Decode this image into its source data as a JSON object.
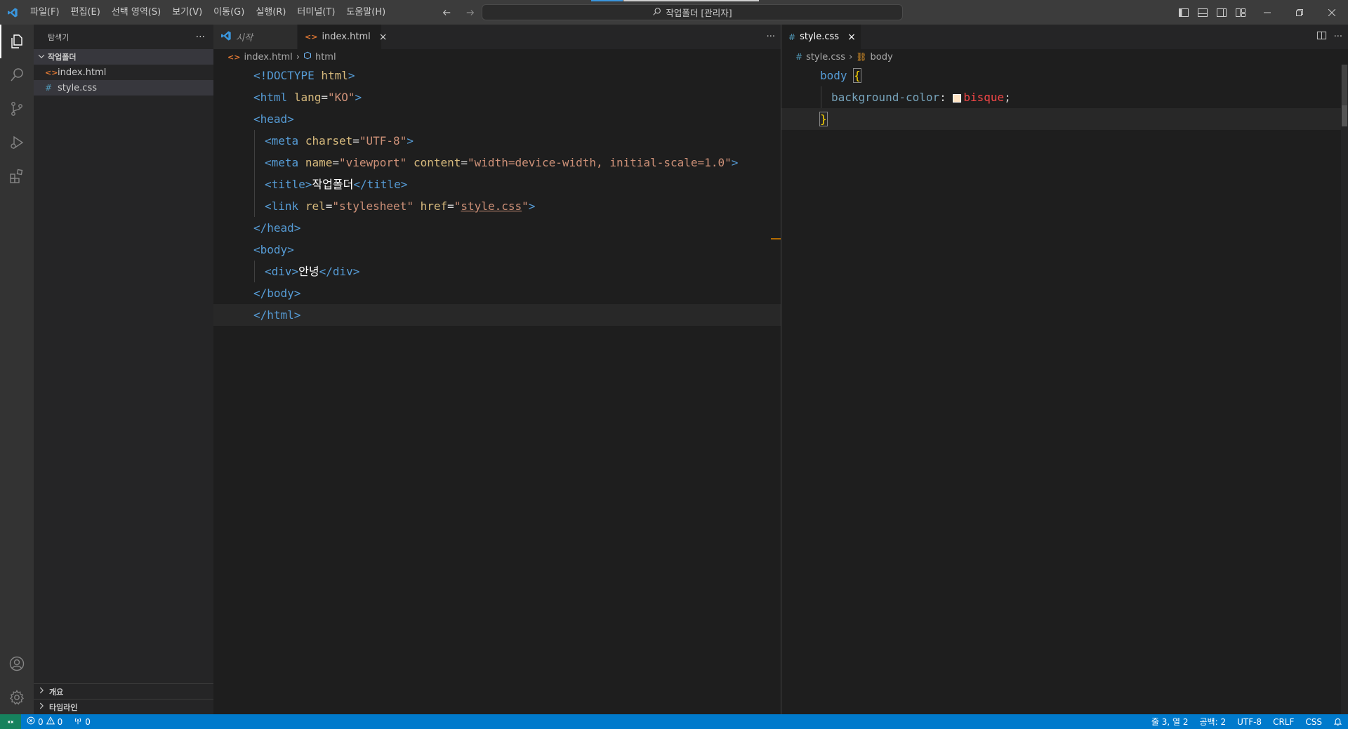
{
  "titlebar": {
    "menu": [
      "파일(F)",
      "편집(E)",
      "선택 영역(S)",
      "보기(V)",
      "이동(G)",
      "실행(R)",
      "터미널(T)",
      "도움말(H)"
    ],
    "search_text": "작업폴더 [관리자]",
    "logo_icon": "vscode-logo-icon"
  },
  "sidebar": {
    "title": "탐색기",
    "more": "···",
    "folder": "작업폴더",
    "files": [
      {
        "name": "index.html",
        "icon": "<>",
        "color": "#e37933"
      },
      {
        "name": "style.css",
        "icon": "#",
        "color": "#519aba"
      }
    ],
    "sections": [
      "개요",
      "타임라인"
    ]
  },
  "left_editor": {
    "tabs": [
      {
        "label": "시작",
        "icon": "vscode-logo-icon"
      },
      {
        "label": "index.html",
        "icon": "<>"
      }
    ],
    "breadcrumb": {
      "file": "index.html",
      "symbol": "html"
    },
    "code": {
      "doctype_open": "<!DOCTYPE ",
      "doctype_html": "html",
      "doctype_close": ">",
      "html_lang_val": "\"KO\"",
      "charset_val": "\"UTF-8\"",
      "viewport_name_val": "\"viewport\"",
      "viewport_content_val": "\"width=device-width, initial-scale=1.0\"",
      "title_text": "작업폴더",
      "link_rel_val": "\"stylesheet\"",
      "link_href_val": "style.css",
      "div_text": "안녕"
    }
  },
  "right_editor": {
    "tab": {
      "label": "style.css",
      "icon": "#"
    },
    "breadcrumb": {
      "file": "style.css",
      "symbol": "body"
    },
    "code": {
      "selector": "body",
      "property": "background-color",
      "value": "bisque",
      "swatch_color": "#ffe4c4"
    }
  },
  "statusbar": {
    "errors": "0",
    "warnings": "0",
    "ports": "0",
    "position": "줄 3, 열 2",
    "spaces": "공백: 2",
    "encoding": "UTF-8",
    "eol": "CRLF",
    "language": "CSS"
  },
  "colors": {
    "accent": "#007acc",
    "html_icon": "#e37933",
    "css_icon": "#519aba"
  }
}
